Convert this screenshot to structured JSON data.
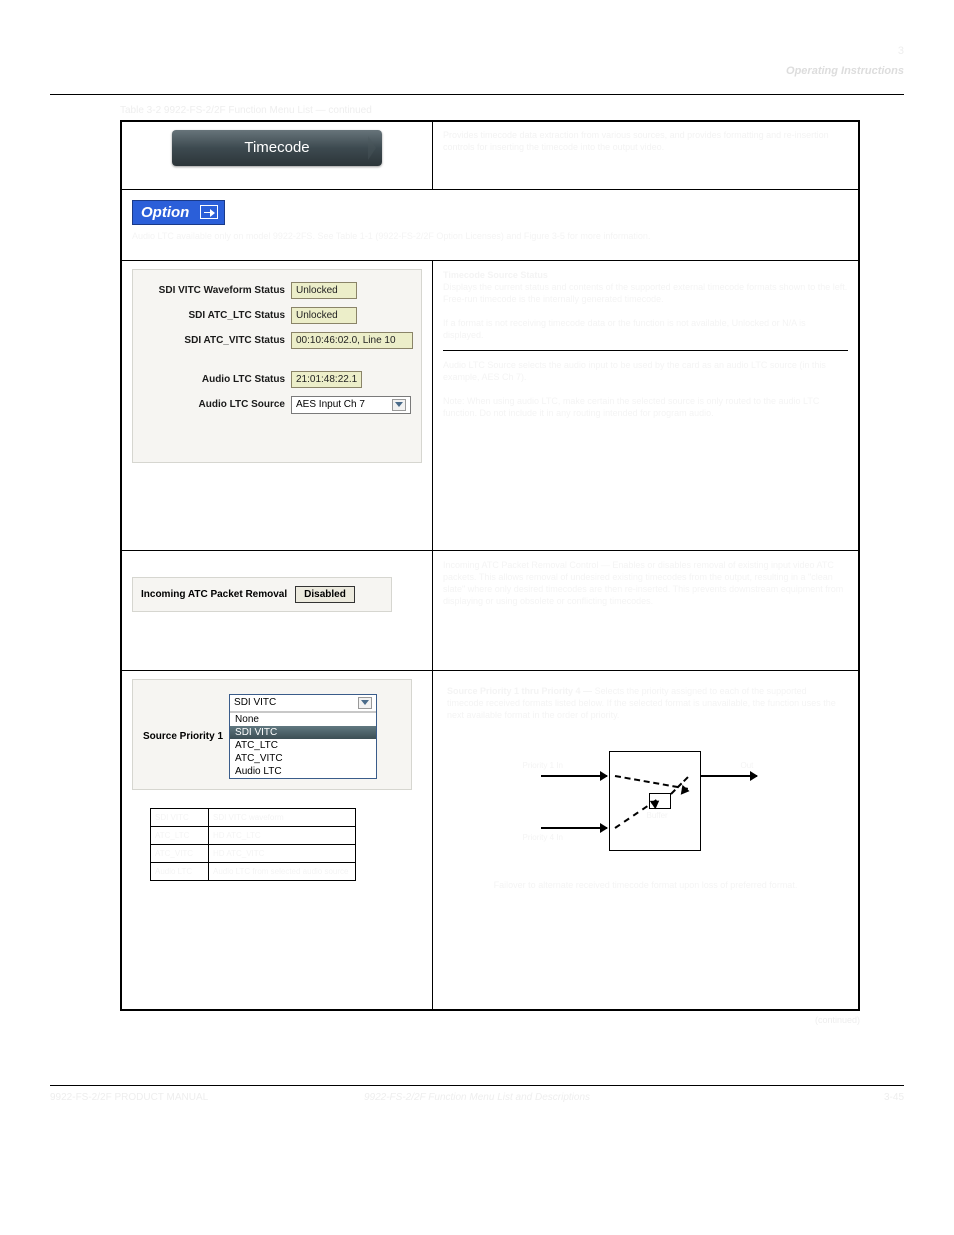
{
  "header": {
    "right_title": "Operating Instructions",
    "chapter_num": "3"
  },
  "table_caption": "Table 3-2  9922-FS-2/2F Function Menu List — continued",
  "row_timecode": {
    "tab_label": "Timecode",
    "desc": "Provides timecode data extraction from various sources, and provides formatting and re-insertion controls for inserting the timecode into the output video."
  },
  "option_row": {
    "banner": "Option",
    "note": "Audio LTC available only on model 9922-2FS. See Table 1-1 (9922-FS-2/2F Option Licenses) and Figure 3-5 for more information."
  },
  "status_panel": {
    "heading_right": "Timecode Source Status",
    "heading_desc": "Displays the current status and contents of the supported external timecode formats shown to the left. Free-run timecode is the internally generated timecode.",
    "rows": [
      {
        "label": "SDI VITC Waveform Status",
        "value": "Unlocked"
      },
      {
        "label": "SDI ATC_LTC Status",
        "value": "Unlocked"
      },
      {
        "label": "SDI ATC_VITC Status",
        "value": "00:10:46:02.0, Line 10"
      }
    ],
    "audio_ltc_status_label": "Audio LTC Status",
    "audio_ltc_status_value": "21:01:48:22.1",
    "audio_ltc_source_label": "Audio LTC Source",
    "audio_ltc_source_value": "AES Input Ch 7",
    "lower_desc_1": "If a format is not receiving timecode data or the function is not available, Unlocked or N/A is displayed.",
    "lower_desc_2": "Audio LTC Source selects the audio input to be used by the card as an audio LTC source (in this example, AES Ch 7).",
    "lower_desc_3": "Note:  When using audio LTC, make certain the selected source is only routed to the audio LTC function. Do not include it in any routing intended for program audio."
  },
  "atc_panel": {
    "label": "Incoming ATC Packet Removal",
    "button": "Disabled",
    "right_desc": "Incoming ATC Packet Removal Control — Enables or disables removal of existing input video ATC packets. This allows removal of undesired existing timecodes from the output, resulting in a \"clean slate\" where only desired timecodes are then re-inserted. This prevents downstream equipment from displaying or using obsolete or conflicting timecodes."
  },
  "priority_panel": {
    "label": "Source Priority 1",
    "selected": "SDI VITC",
    "options": [
      "None",
      "SDI VITC",
      "ATC_LTC",
      "ATC_VITC",
      "Audio LTC"
    ],
    "heading": "Source Priority 1 thru Priority 4 —",
    "heading_desc": "Selects the priority assigned to each of the supported timecode received formats listed below. If the selected format is unavailable, the function uses the next available format in the order of priority.",
    "mini_table": [
      {
        "c1": "SDI VITC",
        "c2": "SDI VITC waveform"
      },
      {
        "c1": "ATC_LTC",
        "c2": "HD ATC_LTC"
      },
      {
        "c1": "ATC_VITC",
        "c2": "HD ATC_VITC"
      },
      {
        "c1": "Audio LTC",
        "c2": "Audio LTC from selected audio source"
      }
    ],
    "diagram": {
      "in1": "Priority 1 In",
      "in2": "Priority 4 In",
      "buf": "Buffer",
      "out": "Out",
      "caption": "Failover to alternate received timecode format upon loss of preferred format."
    }
  },
  "continued": "(continued)",
  "footer": {
    "left": "9922-FS-2/2F PRODUCT MANUAL",
    "center": "9922-FS-2/2F Function Menu List and Descriptions",
    "right": "3-45"
  }
}
